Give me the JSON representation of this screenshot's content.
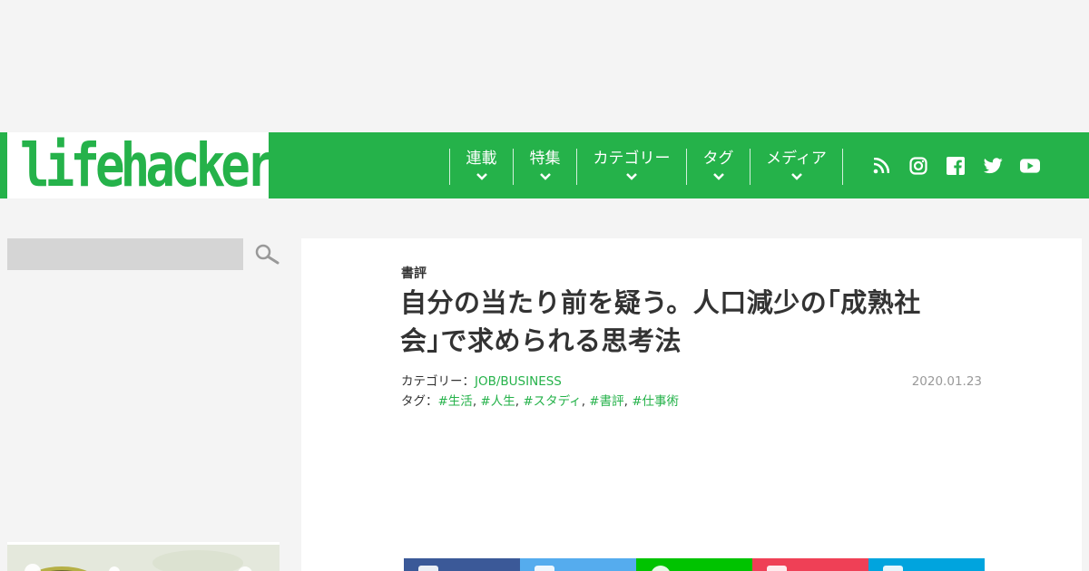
{
  "logo": {
    "text": "lifehacker"
  },
  "nav": {
    "items": [
      {
        "label": "連載"
      },
      {
        "label": "特集"
      },
      {
        "label": "カテゴリー"
      },
      {
        "label": "タグ"
      },
      {
        "label": "メディア"
      }
    ]
  },
  "social": [
    "rss-icon",
    "instagram-icon",
    "facebook-icon",
    "twitter-icon",
    "youtube-icon"
  ],
  "search": {
    "placeholder": ""
  },
  "article": {
    "section": "書評",
    "title_line1": "自分の当たり前を疑う。人口減少の｢成熟社",
    "title_line2": "会｣で求められる思考法",
    "category_label": "カテゴリー：",
    "category_value": "JOB/BUSINESS",
    "tag_label": "タグ：",
    "tags": [
      "#生活",
      "#人生",
      "#スタディ",
      "#書評",
      "#仕事術"
    ],
    "tag_sep": ",",
    "date": "2020.01.23"
  },
  "share": {
    "buttons": [
      {
        "name": "facebook",
        "color": "#3b5998"
      },
      {
        "name": "twitter",
        "color": "#55acee"
      },
      {
        "name": "line",
        "color": "#00c300"
      },
      {
        "name": "pocket",
        "color": "#ef4056"
      },
      {
        "name": "hatena",
        "color": "#00a4de"
      }
    ]
  },
  "colors": {
    "brand": "#25b24a",
    "background": "#f4f4f4",
    "date": "#999999"
  }
}
